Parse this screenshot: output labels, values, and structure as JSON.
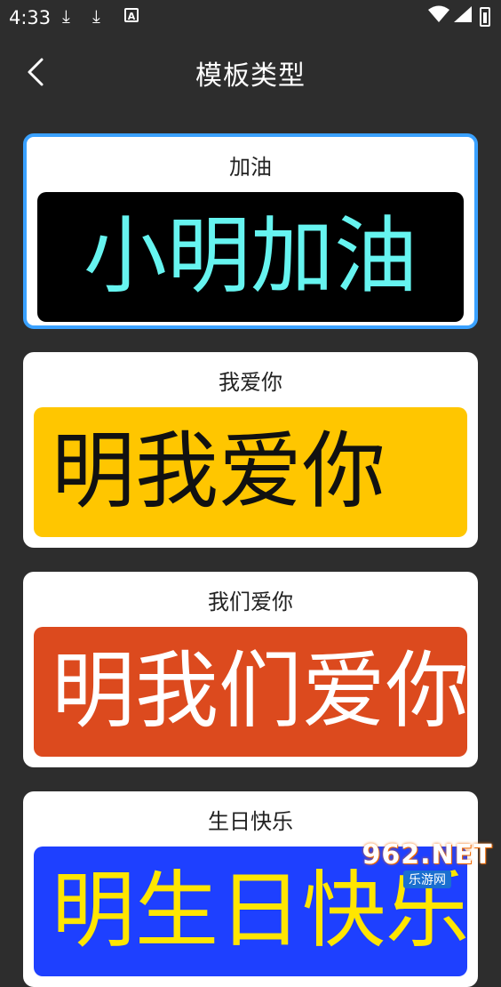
{
  "status": {
    "time": "4:33"
  },
  "header": {
    "title": "模板类型"
  },
  "templates": [
    {
      "label": "加油",
      "preview": "小明加油",
      "bg": "#000000",
      "fg": "#66f4f0",
      "selected": true
    },
    {
      "label": "我爱你",
      "preview": "明我爱你",
      "bg": "#ffc600",
      "fg": "#111111",
      "selected": false
    },
    {
      "label": "我们爱你",
      "preview": "明我们爱你",
      "bg": "#dc4a1e",
      "fg": "#ffffff",
      "selected": false
    },
    {
      "label": "生日快乐",
      "preview": "明生日快乐",
      "bg": "#1e40ff",
      "fg": "#ffe600",
      "selected": false
    }
  ],
  "watermark": {
    "brand": "962.NET",
    "sub": "乐游网"
  },
  "icons": [
    "download-icon",
    "download-icon",
    "a-icon",
    "wifi-icon",
    "signal-icon",
    "battery-icon",
    "back-chevron-icon"
  ],
  "colors": {
    "background": "#2d2d2d",
    "selected_border": "#3aa1ff"
  }
}
